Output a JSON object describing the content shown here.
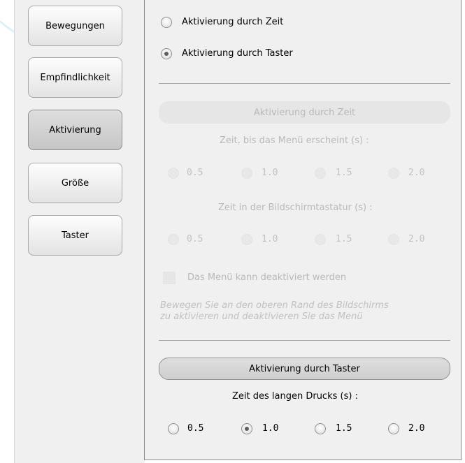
{
  "nav": [
    {
      "label": "Bewegungen",
      "active": false
    },
    {
      "label": "Empfindlichkeit",
      "active": false
    },
    {
      "label": "Aktivierung",
      "active": true
    },
    {
      "label": "Größe",
      "active": false
    },
    {
      "label": "Taster",
      "active": false
    }
  ],
  "activation_mode": {
    "time_label": "Aktivierung durch Zeit",
    "button_label": "Aktivierung durch Taster",
    "selected": "button"
  },
  "time_section": {
    "header": "Aktivierung durch Zeit",
    "menu_delay_label": "Zeit, bis das Menü erscheint (s) :",
    "menu_delay_options": [
      "0.5",
      "1.0",
      "1.5",
      "2.0"
    ],
    "keyboard_time_label": "Zeit in der Bildschirmtastatur (s) :",
    "keyboard_time_options": [
      "0.5",
      "1.0",
      "1.5",
      "2.0"
    ],
    "deactivate_checkbox_label": "Das Menü kann deaktiviert werden",
    "hint_line1": "Bewegen Sie an den oberen Rand des Bildschirms",
    "hint_line2": "zu aktivieren und deaktivieren Sie das Menü"
  },
  "button_section": {
    "header": "Aktivierung durch Taster",
    "long_press_label": "Zeit des langen Drucks (s) :",
    "long_press_options": [
      "0.5",
      "1.0",
      "1.5",
      "2.0"
    ],
    "long_press_selected": "1.0"
  }
}
